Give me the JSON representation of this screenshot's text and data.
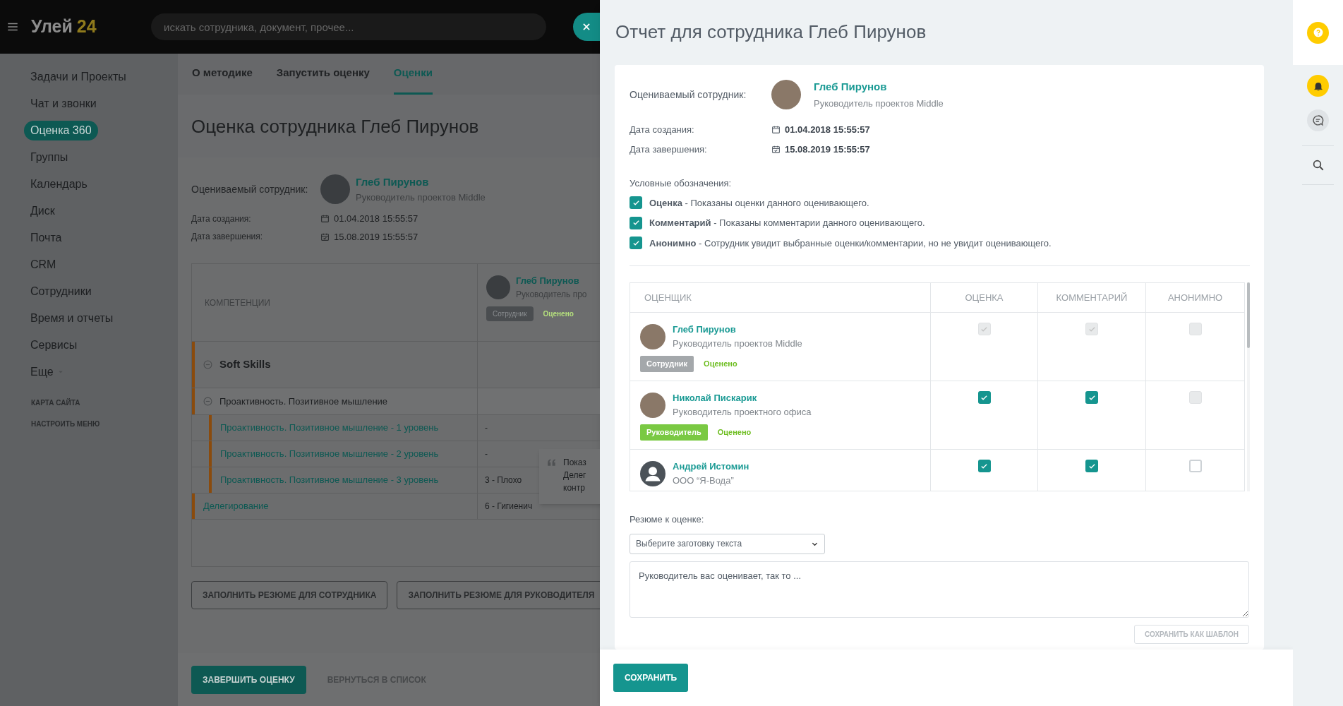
{
  "top_bar": {
    "logo_text": "Улей",
    "logo_number": "24",
    "search": {
      "placeholder": "искать сотрудника, документ, прочее..."
    }
  },
  "sidebar": {
    "items": [
      {
        "label": "Задачи и Проекты",
        "selected": false
      },
      {
        "label": "Чат и звонки",
        "selected": false
      },
      {
        "label": "Оценка 360",
        "selected": true
      },
      {
        "label": "Группы",
        "selected": false
      },
      {
        "label": "Календарь",
        "selected": false
      },
      {
        "label": "Диск",
        "selected": false
      },
      {
        "label": "Почта",
        "selected": false
      },
      {
        "label": "CRM",
        "selected": false
      },
      {
        "label": "Сотрудники",
        "selected": false
      },
      {
        "label": "Время и отчеты",
        "selected": false
      },
      {
        "label": "Сервисы",
        "selected": false
      }
    ],
    "more": "Еще",
    "links": [
      "КАРТА САЙТА",
      "НАСТРОИТЬ МЕНЮ"
    ]
  },
  "tabs": [
    {
      "label": "О методике",
      "selected": false
    },
    {
      "label": "Запустить оценку",
      "selected": false
    },
    {
      "label": "Оценки",
      "selected": true
    }
  ],
  "page": {
    "title": "Оценка сотрудника Глеб Пирунов",
    "employee": {
      "label": "Оцениваемый сотрудник:",
      "name": "Глеб Пирунов",
      "position": "Руководитель проектов Middle"
    },
    "dates": [
      {
        "kind": "created",
        "label": "Дата создания:",
        "value": "01.04.2018 15:55:57"
      },
      {
        "kind": "finished",
        "label": "Дата завершения:",
        "value": "15.08.2019 15:55:57"
      }
    ],
    "competency_table": {
      "column_header": "КОМПЕТЕНЦИИ",
      "assessor": {
        "name": "Глеб Пирунов",
        "position": "Руководитель про",
        "role": "Сотрудник",
        "status": "Оценено"
      },
      "rows": [
        {
          "label": "Soft Skills",
          "kind": "group",
          "expanded": true,
          "children": [
            {
              "label": "Проактивность. Позитивное мышление",
              "kind": "subgroup",
              "expanded": true,
              "children": [
                {
                  "label": "Проактивность. Позитивное мышление - 1 уровень",
                  "kind": "item",
                  "score": "-"
                },
                {
                  "label": "Проактивность. Позитивное мышление - 2 уровень",
                  "kind": "item",
                  "score": "-"
                },
                {
                  "label": "Проактивность. Позитивное мышление - 3 уровень",
                  "kind": "item",
                  "score": "3 - Плохо"
                }
              ]
            }
          ]
        },
        {
          "label": "Делегирование",
          "kind": "item",
          "score": "6 - Гигиенич"
        }
      ]
    },
    "tooltip": {
      "lines": [
        "Показ",
        "Делег",
        "контр"
      ]
    },
    "buttons": [
      "ЗАПОЛНИТЬ РЕЗЮМЕ ДЛЯ СОТРУДНИКА",
      "ЗАПОЛНИТЬ РЕЗЮМЕ ДЛЯ РУКОВОДИТЕЛЯ"
    ],
    "footer": {
      "primary": "ЗАВЕРШИТЬ ОЦЕНКУ",
      "secondary": "ВЕРНУТЬСЯ В СПИСОК"
    }
  },
  "report_panel": {
    "title": "Отчет для сотрудника Глеб Пирунов",
    "employee": {
      "label": "Оцениваемый сотрудник:",
      "name": "Глеб Пирунов",
      "position": "Руководитель проектов Middle"
    },
    "dates": [
      {
        "kind": "created",
        "label": "Дата создания:",
        "value": "01.04.2018 15:55:57"
      },
      {
        "kind": "finished",
        "label": "Дата завершения:",
        "value": "15.08.2019 15:55:57"
      }
    ],
    "legend": {
      "title": "Условные обозначения:",
      "items": [
        {
          "text": "**Оценка** - Показаны оценки данного оценивающего.",
          "checked": true
        },
        {
          "text": "**Комментарий** - Показаны комментарии данного оценивающего.",
          "checked": true
        },
        {
          "text": "**Анонимно** - Сотрудник увидит выбранные оценки/комментарии, но не увидит оценивающего.",
          "checked": true
        }
      ]
    },
    "assessors": {
      "columns": [
        "ОЦЕНЩИК",
        "ОЦЕНКА",
        "КОММЕНТАРИЙ",
        "АНОНИМНО"
      ],
      "rows": [
        {
          "name": "Глеб Пирунов",
          "position": "Руководитель проектов Middle",
          "avatar": {
            "kind": "photo"
          },
          "role": {
            "label": "Сотрудник",
            "color": "#a4a8ab"
          },
          "status": "Оценено",
          "score": {
            "checked": true,
            "disabled": true
          },
          "comment": {
            "checked": true,
            "disabled": true
          },
          "anonymous": {
            "checked": false,
            "disabled": true
          }
        },
        {
          "name": "Николай Пискарик",
          "position": "Руководитель проектного офиса",
          "avatar": {
            "kind": "photo"
          },
          "role": {
            "label": "Руководитель",
            "color": "#7ac943"
          },
          "status": "Оценено",
          "score": {
            "checked": true,
            "disabled": false
          },
          "comment": {
            "checked": true,
            "disabled": false
          },
          "anonymous": {
            "checked": false,
            "disabled": true
          }
        },
        {
          "name": "Андрей Истомин",
          "position": "ООО “Я-Вода”",
          "avatar": {
            "kind": "silhouette"
          },
          "score": {
            "checked": true,
            "disabled": false
          },
          "comment": {
            "checked": true,
            "disabled": false
          },
          "anonymous": {
            "checked": false,
            "disabled": false
          }
        }
      ]
    },
    "summary": {
      "label": "Резюме к оценке:",
      "template_select": {
        "value": "Выберите заготовку текста"
      },
      "text": "Руководитель вас оценивает, так то ...",
      "save_template_button": "СОХРАНИТЬ КАК ШАБЛОН"
    },
    "save_button": "СОХРАНИТЬ"
  }
}
